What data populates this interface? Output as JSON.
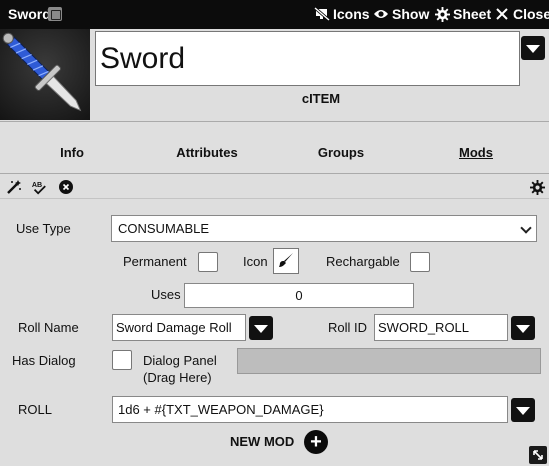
{
  "window": {
    "title": "Sword",
    "buttons": {
      "icons": "Icons",
      "show": "Show",
      "sheet": "Sheet",
      "close": "Close"
    }
  },
  "item": {
    "name": "Sword",
    "type_label": "cITEM"
  },
  "tabs": [
    {
      "label": "Info"
    },
    {
      "label": "Attributes"
    },
    {
      "label": "Groups"
    },
    {
      "label": "Mods",
      "active": true
    }
  ],
  "toolbar": {
    "icons": [
      "magic-wand-icon",
      "spellcheck-icon",
      "clear-icon",
      "gear-icon"
    ]
  },
  "form": {
    "use_type": {
      "label": "Use Type",
      "value": "CONSUMABLE"
    },
    "permanent": {
      "label": "Permanent",
      "checked": false
    },
    "icon": {
      "label": "Icon"
    },
    "rechargable": {
      "label": "Rechargable",
      "checked": false
    },
    "uses": {
      "label": "Uses",
      "value": "0"
    },
    "roll_name": {
      "label": "Roll Name",
      "value": "Sword Damage Roll"
    },
    "roll_id": {
      "label": "Roll ID",
      "value": "SWORD_ROLL"
    },
    "has_dialog": {
      "label": "Has Dialog",
      "checked": false
    },
    "dialog_panel": {
      "label_line1": "Dialog Panel",
      "label_line2": "(Drag Here)"
    },
    "roll": {
      "label": "ROLL",
      "value": "1d6 + #{TXT_WEAPON_DAMAGE}"
    }
  },
  "actions": {
    "new_mod": "NEW MOD",
    "add": "+"
  }
}
